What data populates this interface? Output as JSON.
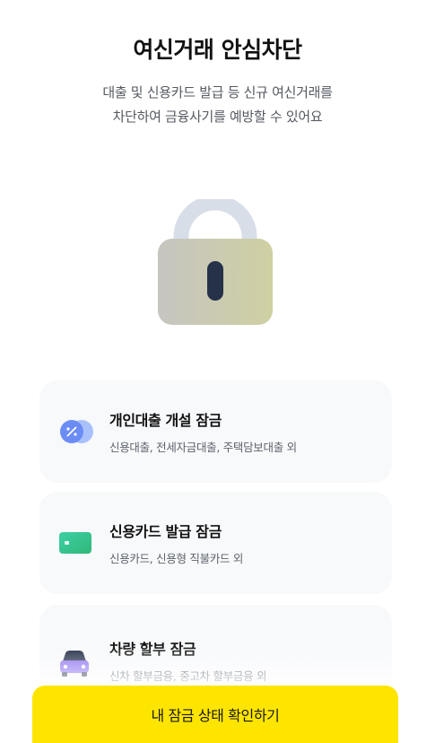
{
  "header": {
    "title": "여신거래 안심차단",
    "subtitle_line1": "대출 및 신용카드 발급 등 신규 여신거래를",
    "subtitle_line2": "차단하여 금융사기를 예방할 수 있어요"
  },
  "hero": {
    "icon": "padlock-icon"
  },
  "cards": [
    {
      "title": "개인대출 개설 잠금",
      "desc": "신용대출, 전세자금대출, 주택담보대출 외",
      "icon": "percent-coin-icon"
    },
    {
      "title": "신용카드 발급 잠금",
      "desc": "신용카드, 신용형 직불카드 외",
      "icon": "credit-card-icon"
    },
    {
      "title": "차량 할부 잠금",
      "desc": "신차 할부금융, 중고차 할부금융 외",
      "icon": "car-icon"
    }
  ],
  "cta": {
    "label": "내 잠금 상태 확인하기"
  },
  "colors": {
    "accent": "#fee500",
    "card_bg": "#f8f9fb",
    "icon_blue": "#6c8cf5",
    "icon_purple": "#8a6cf0"
  }
}
